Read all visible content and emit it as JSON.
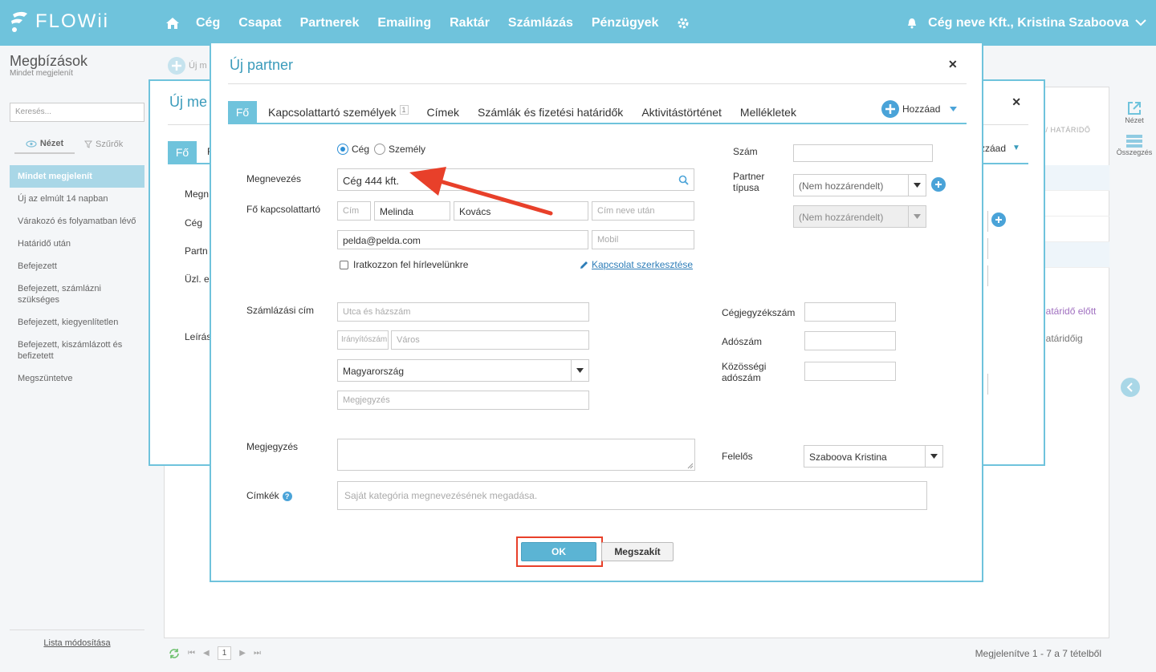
{
  "app": {
    "logo_text": "FLOWii",
    "nav": [
      "Cég",
      "Csapat",
      "Partnerek",
      "Emailing",
      "Raktár",
      "Számlázás",
      "Pénzügyek"
    ],
    "account": "Cég neve Kft., Kristina Szaboova"
  },
  "sidebar": {
    "title": "Megbízások",
    "subtitle": "Mindet megjelenít",
    "search_placeholder": "Keresés...",
    "tab_view": "Nézet",
    "tab_filters": "Szűrők",
    "items": [
      "Mindet megjelenít",
      "Új az elmúlt 14 napban",
      "Várakozó és folyamatban lévő",
      "Határidő után",
      "Befejezett",
      "Befejezett, számlázni szükséges",
      "Befejezett, kiegyenlítetlen",
      "Befejezett, kiszámlázott és befizetett",
      "Megszüntetve"
    ],
    "footer_link": "Lista módosítása"
  },
  "main": {
    "new_button": "Új m",
    "crumb": "G / HATÁRIDŐ",
    "row_text_1": "határidő előtt",
    "row_text_2": "határidőig",
    "pager_page": "1",
    "pager_info": "Megjelenítve 1 - 7 a 7 tételből",
    "right_tools": [
      "Nézet",
      "Összegzés"
    ]
  },
  "bg_modal": {
    "title": "Új me",
    "tab": "Fő",
    "tab2": "F",
    "labels": [
      "Megn",
      "Cég",
      "Partn",
      "Üzl. e",
      "Leírás"
    ],
    "add": "zzáad"
  },
  "modal": {
    "title": "Új partner",
    "tabs": [
      "Fő",
      "Kapcsolattartó személyek",
      "Címek",
      "Számlák és fizetési határidők",
      "Aktivitástörténet",
      "Mellékletek"
    ],
    "contacts_count": "1",
    "add_label": "Hozzáad",
    "radio_company": "Cég",
    "radio_person": "Személy",
    "name_label": "Megnevezés",
    "name_value": "Cég 444 kft.",
    "contact_label": "Fő kapcsolattartó",
    "contact_title_placeholder": "Cím",
    "contact_first": "Melinda",
    "contact_last": "Kovács",
    "contact_suffix_placeholder": "Cím neve után",
    "contact_email": "pelda@pelda.com",
    "contact_mobile_placeholder": "Mobil",
    "newsletter": "Iratkozzon fel hírlevelünkre",
    "edit_contact": "Kapcsolat szerkesztése",
    "number_label": "Szám",
    "partner_type_label": "Partner típusa",
    "partner_type_value": "(Nem hozzárendelt)",
    "partner_sub_value": "(Nem hozzárendelt)",
    "billing_label": "Számlázási cím",
    "street_placeholder": "Utca és házszám",
    "zip_placeholder": "Irányítószám",
    "city_placeholder": "Város",
    "country": "Magyarország",
    "note_placeholder": "Megjegyzés",
    "reg_label": "Cégjegyzékszám",
    "tax_label": "Adószám",
    "eu_tax_label": "Közösségi adószám",
    "comment_label": "Megjegyzés",
    "owner_label": "Felelős",
    "owner_value": "Szaboova Kristina",
    "tags_label": "Címkék",
    "tags_placeholder": "Saját kategória megnevezésének megadása.",
    "ok": "OK",
    "cancel": "Megszakít"
  },
  "colors": {
    "brand": "#6fc3dc",
    "title": "#3a9bbb",
    "annotation": "#e8402a"
  }
}
